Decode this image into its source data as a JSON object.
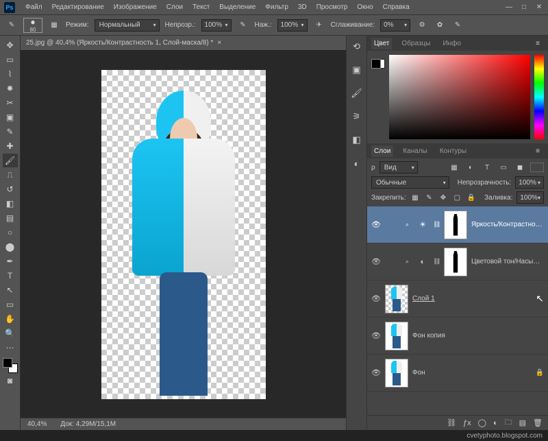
{
  "menubar": {
    "items": [
      "Файл",
      "Редактирование",
      "Изображение",
      "Слои",
      "Текст",
      "Выделение",
      "Фильтр",
      "3D",
      "Просмотр",
      "Окно",
      "Справка"
    ]
  },
  "options": {
    "brush_size": "80",
    "mode_label": "Режим:",
    "mode_value": "Нормальный",
    "opacity_label": "Непрозр.:",
    "opacity_value": "100%",
    "flow_label": "Наж.:",
    "flow_value": "100%",
    "smoothing_label": "Сглаживание:",
    "smoothing_value": "0%"
  },
  "document": {
    "tab_title": "25.jpg @ 40,4% (Яркость/Контрастность 1, Слой-маска/8) *",
    "zoom": "40,4%",
    "doc_size_label": "Док:",
    "doc_size": "4,29M/15,1M"
  },
  "panels": {
    "color": {
      "tabs": [
        "Цвет",
        "Образцы",
        "Инфо"
      ],
      "active": 0
    },
    "layers": {
      "tabs": [
        "Слои",
        "Каналы",
        "Контуры"
      ],
      "active": 0,
      "filter_label": "Вид",
      "blend_mode": "Обычные",
      "opacity_label": "Непрозрачность:",
      "opacity_value": "100%",
      "lock_label": "Закрепить:",
      "fill_label": "Заливка:",
      "fill_value": "100%",
      "list": [
        {
          "visible": true,
          "type": "adjustment",
          "icon": "☀",
          "name": "Яркость/Контрастнос...",
          "has_mask": true,
          "selected": true
        },
        {
          "visible": true,
          "type": "adjustment",
          "icon": "◐",
          "name": "Цветовой тон/Насыщ...",
          "has_mask": true
        },
        {
          "visible": true,
          "type": "image",
          "name": "Слой 1",
          "transparent_bg": true
        },
        {
          "visible": true,
          "type": "image",
          "name": "Фон копия"
        },
        {
          "visible": true,
          "type": "image",
          "name": "Фон",
          "locked": true
        }
      ]
    }
  },
  "footer": {
    "watermark": "cvetyphoto.blogspot.com"
  }
}
